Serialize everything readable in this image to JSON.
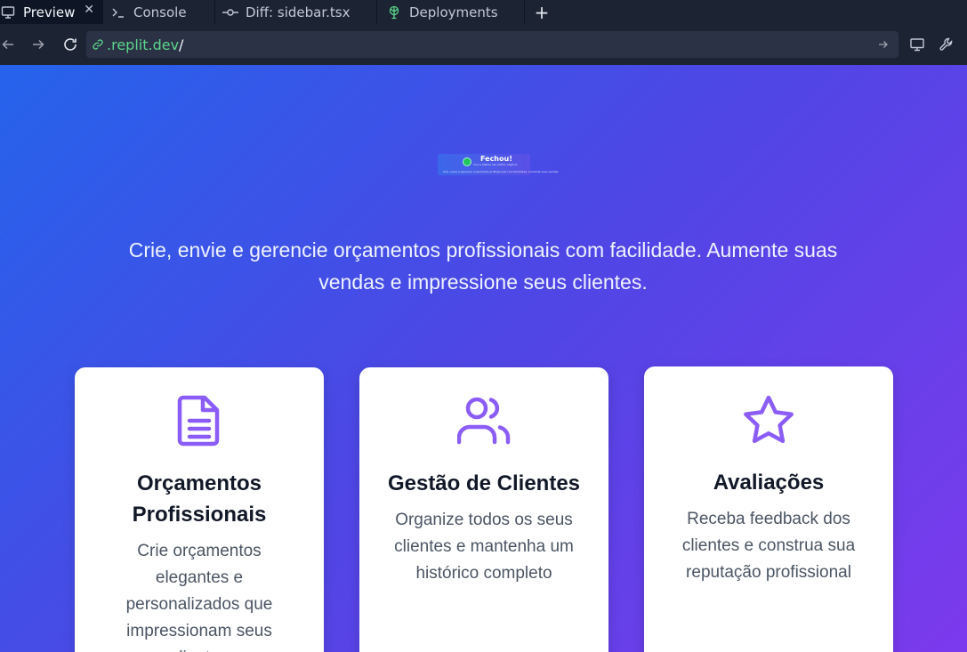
{
  "tabs": [
    {
      "label": "Preview",
      "icon": "monitor-icon",
      "active": true
    },
    {
      "label": "Console",
      "icon": "terminal-icon"
    },
    {
      "label": "Diff: sidebar.tsx",
      "icon": "git-commit-icon"
    },
    {
      "label": "Deployments",
      "icon": "deploy-icon"
    }
  ],
  "tab_close": "✕",
  "tab_add": "+",
  "url": {
    "domain": ".replit.dev",
    "path": "/"
  },
  "page": {
    "logo": {
      "name": "Fechou!",
      "tagline": "Crie e efetive seu último negócio",
      "subtitle": "Crie, envie e gerencie orçamentos profissionais com facilidade. Aumente suas vendas."
    },
    "hero_text": "Crie, envie e gerencie orçamentos profissionais com facilidade. Aumente suas vendas e impressione seus clientes.",
    "features": [
      {
        "icon": "document-icon",
        "title": "Orçamentos Profissionais",
        "desc": "Crie orçamentos elegantes e personalizados que impressionam seus clientes"
      },
      {
        "icon": "users-icon",
        "title": "Gestão de Clientes",
        "desc": "Organize todos os seus clientes e mantenha um histórico completo"
      },
      {
        "icon": "star-icon",
        "title": "Avaliações",
        "desc": "Receba feedback dos clientes e construa sua reputação profissional"
      }
    ]
  },
  "colors": {
    "accent": "#8b5cf6",
    "link_green": "#5bd58b",
    "gradient_start": "#2563eb",
    "gradient_end": "#7c3aed"
  }
}
